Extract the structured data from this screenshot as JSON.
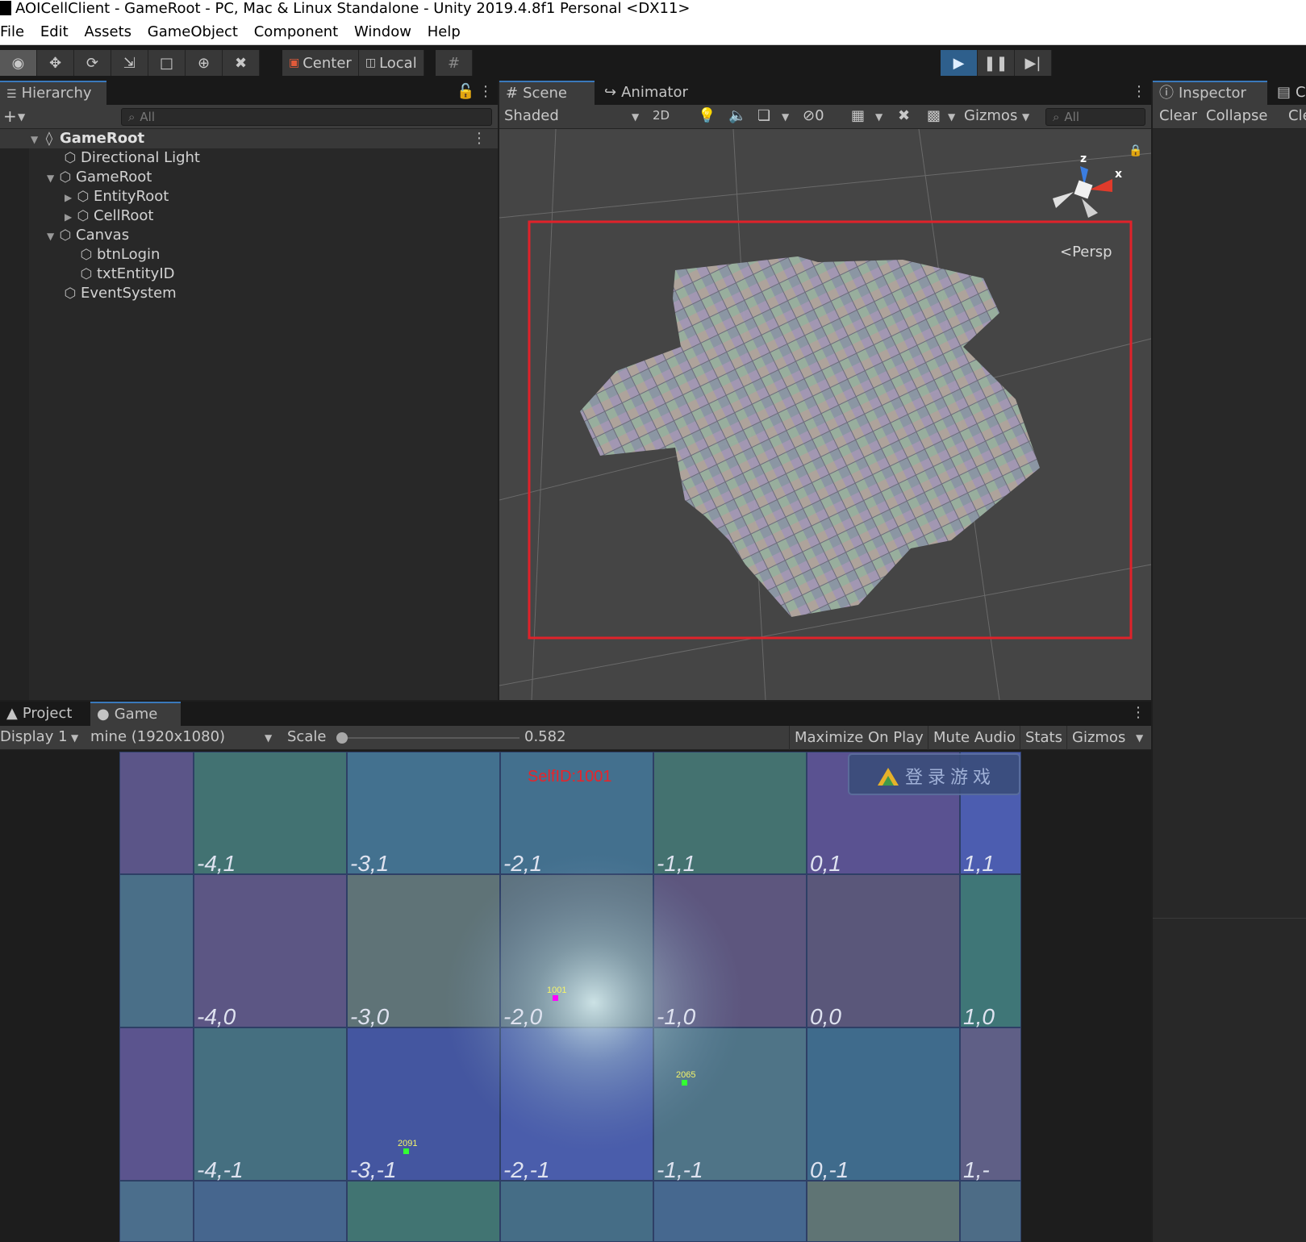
{
  "window": {
    "title": "AOICellClient - GameRoot - PC, Mac & Linux Standalone - Unity 2019.4.8f1 Personal <DX11>"
  },
  "menu": {
    "items": [
      "File",
      "Edit",
      "Assets",
      "GameObject",
      "Component",
      "Window",
      "Help"
    ]
  },
  "toolbar": {
    "tools": [
      "eye-icon",
      "move-icon",
      "rotate-icon",
      "scale-icon",
      "rect-icon",
      "transform-icon",
      "custom-tool-icon"
    ],
    "pivot_label": "Center",
    "space_label": "Local",
    "play_state": "playing"
  },
  "hierarchy": {
    "tab_label": "Hierarchy",
    "search_placeholder": "All",
    "root": "GameRoot",
    "items": [
      {
        "label": "Directional Light"
      },
      {
        "label": "GameRoot"
      },
      {
        "label": "EntityRoot"
      },
      {
        "label": "CellRoot"
      },
      {
        "label": "Canvas"
      },
      {
        "label": "btnLogin"
      },
      {
        "label": "txtEntityID"
      },
      {
        "label": "EventSystem"
      }
    ]
  },
  "scene": {
    "tab_scene": "Scene",
    "tab_animator": "Animator",
    "shading_mode": "Shaded",
    "mode_2d": "2D",
    "hidden_count": "0",
    "gizmos_label": "Gizmos",
    "search_placeholder": "All",
    "persp_label": "Persp",
    "axis_x": "x",
    "axis_z": "z",
    "highlight_color": "#e0222a"
  },
  "inspector": {
    "tab_label": "Inspector",
    "tab_console": "C",
    "clear_label": "Clear",
    "collapse_label": "Collapse",
    "extra_label": "Cle"
  },
  "game": {
    "tab_project": "Project",
    "tab_game": "Game",
    "display_label": "Display 1",
    "resolution_label": "mine (1920x1080)",
    "scale_label": "Scale",
    "scale_value": "0.582",
    "maximize_label": "Maximize On Play",
    "mute_label": "Mute Audio",
    "stats_label": "Stats",
    "gizmos_label": "Gizmos",
    "self_id_text": "SelfID:1001",
    "login_button_text": "登录游戏",
    "cells": [
      [
        "-4,1",
        "-3,1",
        "-2,1",
        "-1,1",
        "0,1",
        "1,1"
      ],
      [
        "-4,0",
        "-3,0",
        "-2,0",
        "-1,0",
        "0,0",
        "1,0"
      ],
      [
        "-4,-1",
        "-3,-1",
        "-2,-1",
        "-1,-1",
        "0,-1",
        "1,-"
      ]
    ],
    "entities": [
      {
        "id": "1001",
        "color": "#ff00ff"
      },
      {
        "id": "2065",
        "color": "#33ff33"
      },
      {
        "id": "2091",
        "color": "#33ff33"
      }
    ]
  }
}
